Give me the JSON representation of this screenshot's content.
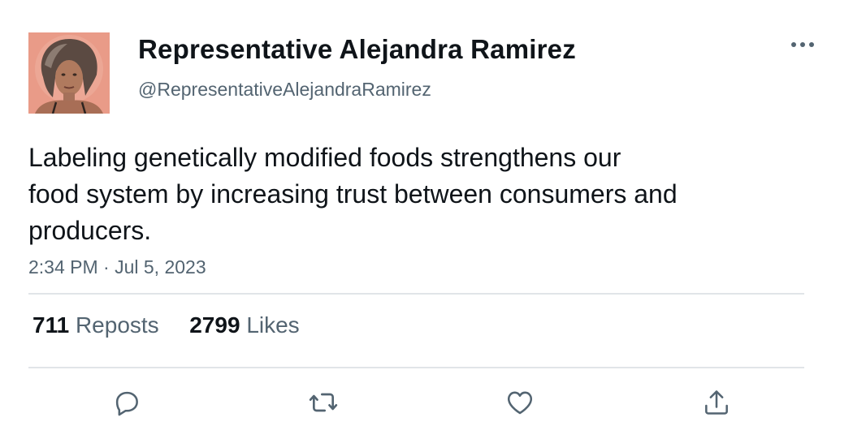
{
  "tweet": {
    "author": {
      "display_name": "Representative Alejandra Ramirez",
      "handle": "@RepresentativeAlejandraRamirez"
    },
    "text_lines": [
      "Labeling genetically modified foods strengthens our",
      "food system by increasing trust between consumers and",
      "producers."
    ],
    "timestamp": "2:34 PM · Jul 5, 2023",
    "stats": {
      "reposts_count": "711",
      "reposts_label": "Reposts",
      "likes_count": "2799",
      "likes_label": "Likes"
    }
  },
  "icons": {
    "more": "more-dots-icon",
    "reply": "reply-icon",
    "repost": "repost-icon",
    "like": "heart-icon",
    "share": "share-icon"
  },
  "colors": {
    "text_primary": "#0f1419",
    "text_secondary": "#536471",
    "divider": "#e1e5e8"
  }
}
